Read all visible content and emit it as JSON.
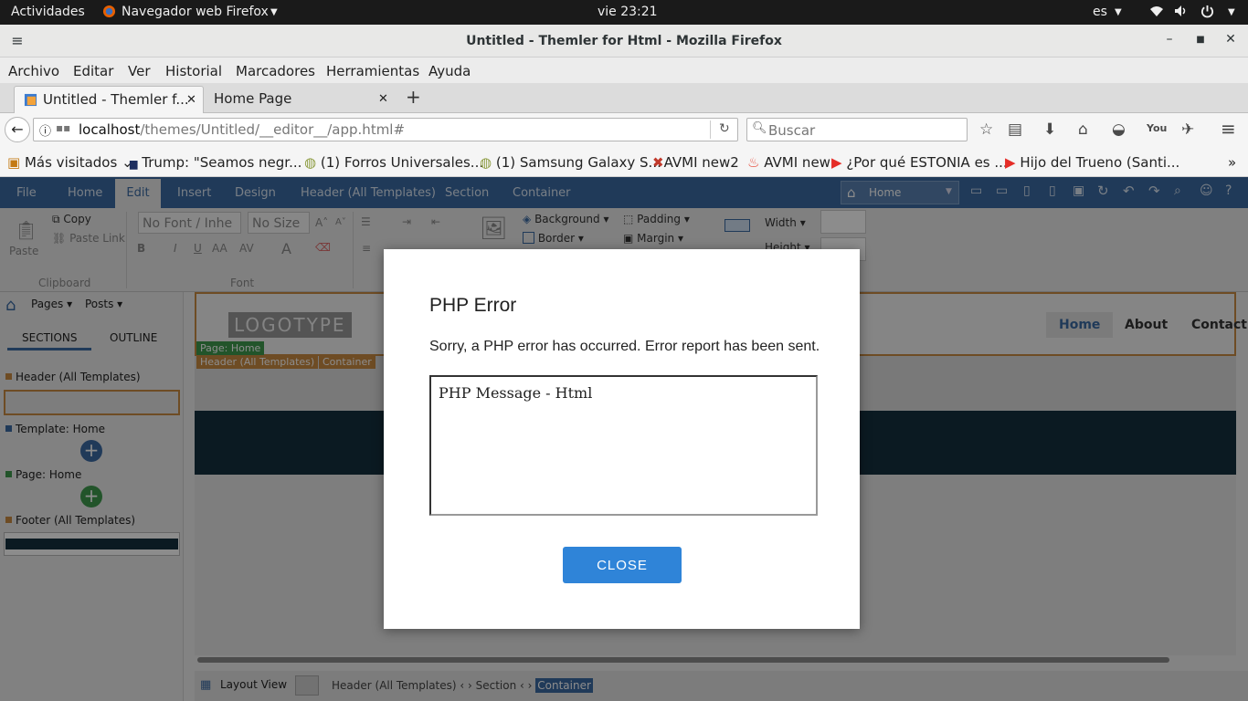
{
  "system": {
    "activities": "Actividades",
    "app_name": "Navegador web Firefox",
    "clock": "vie 23:21",
    "lang": "es"
  },
  "window": {
    "title": "Untitled - Themler for Html - Mozilla Firefox"
  },
  "menubar": [
    "Archivo",
    "Editar",
    "Ver",
    "Historial",
    "Marcadores",
    "Herramientas",
    "Ayuda"
  ],
  "tabs": [
    {
      "label": "Untitled - Themler f..."
    },
    {
      "label": "Home Page"
    }
  ],
  "urlbar": {
    "host": "localhost",
    "path": "/themes/Untitled/__editor__/app.html#"
  },
  "search": {
    "placeholder": "Buscar"
  },
  "bookmarks": [
    "Más visitados",
    "Trump: \"Seamos negr...",
    "(1) Forros Universales...",
    "(1) Samsung Galaxy S...",
    "AVMI new2",
    "AVMI new",
    "¿Por qué ESTONIA es ...",
    "Hijo del Trueno (Santi..."
  ],
  "ribbon": {
    "tabs": [
      "File",
      "Home",
      "Edit",
      "Insert",
      "Design",
      "Header (All Templates)",
      "Section",
      "Container"
    ],
    "page_select": "Home",
    "clipboard": {
      "paste": "Paste",
      "copy": "Copy",
      "paste_link": "Paste Link",
      "group": "Clipboard"
    },
    "font": {
      "family": "No Font / Inhe",
      "size": "No Size",
      "group": "Font"
    },
    "props": {
      "background": "Background",
      "border": "Border",
      "padding": "Padding",
      "margin": "Margin",
      "width": "Width",
      "height": "Height"
    }
  },
  "leftpanel": {
    "pages": "Pages",
    "posts": "Posts",
    "sections_tab": "SECTIONS",
    "outline_tab": "OUTLINE",
    "items": [
      "Header (All Templates)",
      "Template: Home",
      "Page: Home",
      "Footer (All Templates)"
    ]
  },
  "canvas": {
    "logo": "LOGOTYPE",
    "page_label": "Page: Home",
    "header_label": "Header (All Templates)",
    "container_label": "Container",
    "nav": [
      "Home",
      "About",
      "Contact"
    ]
  },
  "bottombar": {
    "layout_view": "Layout View",
    "crumbs": [
      "Header (All Templates)",
      "Section",
      "Container"
    ]
  },
  "dialog": {
    "title": "PHP Error",
    "message": "Sorry, a PHP error has occurred. Error report has been sent.",
    "detail": "PHP Message - Html",
    "close": "CLOSE"
  },
  "colors": {
    "ribbon": "#3b6aa3",
    "button": "#2f84d8",
    "dark_band": "#15313f",
    "accent_orange": "#c98a43"
  }
}
